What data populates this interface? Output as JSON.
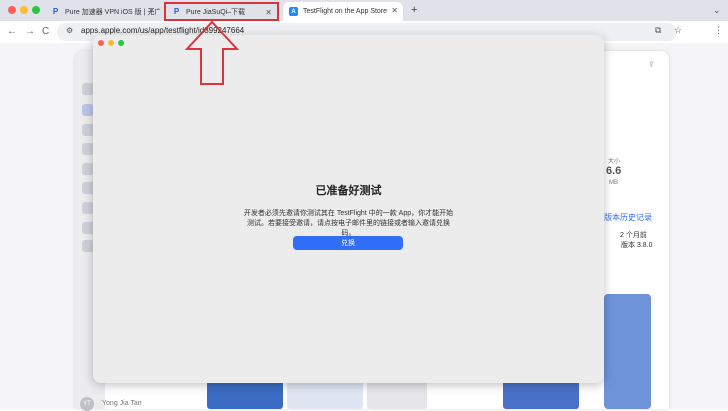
{
  "tabs": [
    {
      "title": "Pure 加速器 VPN iOS 版 | 无广"
    },
    {
      "title": "Pure JiaSuQi–下载"
    },
    {
      "title": "TestFlight on the App Store"
    }
  ],
  "new_tab_label": "+",
  "favicons": {
    "pure": "P",
    "appstore": "A"
  },
  "address": {
    "url": "apps.apple.com/us/app/testflight/id899247664"
  },
  "nav": {
    "back": "←",
    "forward": "→",
    "reload": "C"
  },
  "background_page": {
    "size_label": "大小",
    "size_value": "6.6",
    "size_unit": "MB",
    "version_history_link": "版本历史记录",
    "release_time": "2 个月前",
    "version": "版本 3.8.0",
    "user_initials": "YT",
    "user_name": "Yong Jia Tan"
  },
  "modal": {
    "title": "已准备好测试",
    "description": "开发者必须先邀请你测试其在 TestFlight 中的一款 App，你才能开始测试。若要接受邀请，请点按电子邮件里的链接或者输入邀请兑换码。",
    "redeem_button": "兑换"
  },
  "colors": {
    "accent": "#2f6ef5",
    "highlight": "#d9343b"
  }
}
